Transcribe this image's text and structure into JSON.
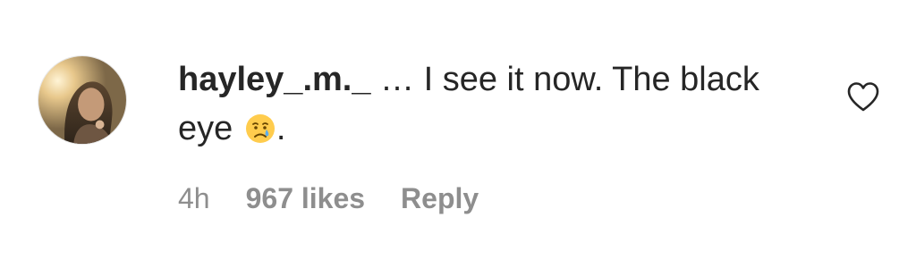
{
  "comment": {
    "username": "hayley_.m._",
    "text_before_emoji": " … I see it now. The black eye ",
    "emoji_name": "crying-face-icon",
    "text_after_emoji": ".",
    "time_ago": "4h",
    "likes_label": "967 likes",
    "reply_label": "Reply"
  },
  "icons": {
    "like": "heart-outline-icon",
    "avatar": "profile-avatar"
  },
  "colors": {
    "text_primary": "#262626",
    "text_secondary": "#8e8e8e"
  }
}
